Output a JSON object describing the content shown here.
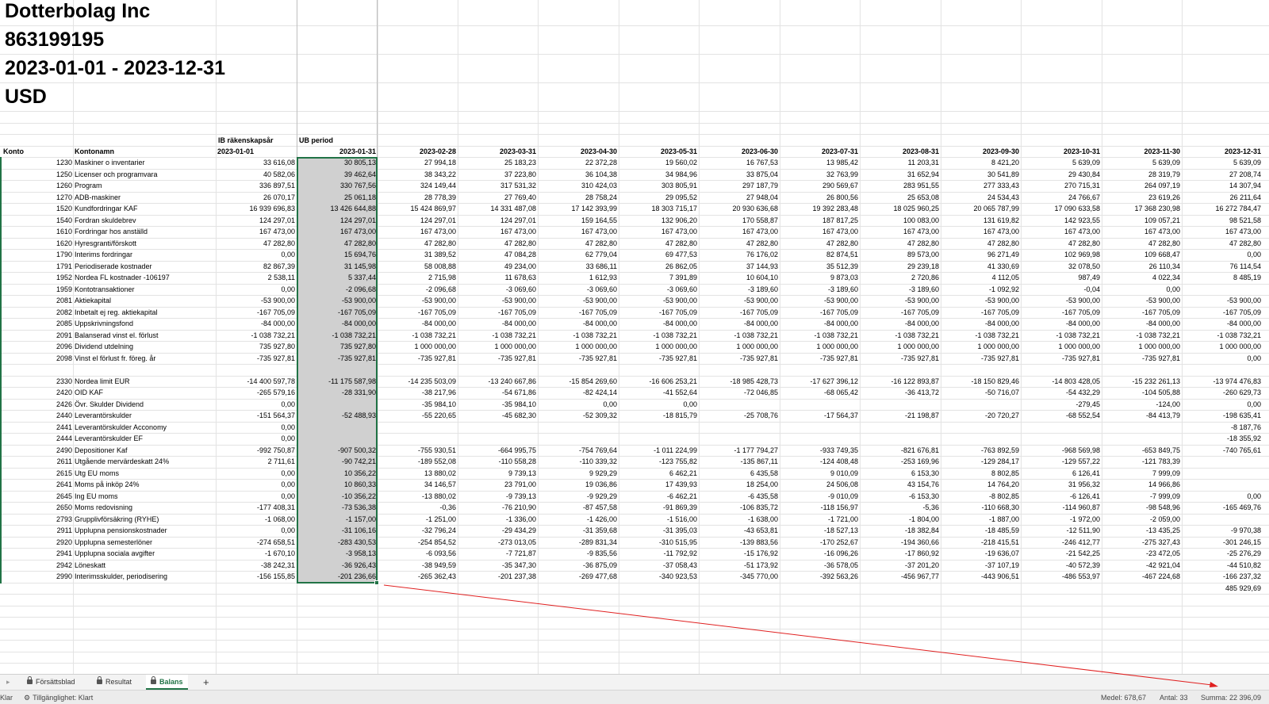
{
  "company": {
    "name": "Dotterbolag Inc",
    "org_number": "863199195",
    "period": "2023-01-01 - 2023-12-31",
    "currency": "USD"
  },
  "table": {
    "col_header_ib": "IB räkenskapsår",
    "col_header_ub": "UB period",
    "header_konto": "Konto",
    "header_kontonamn": "Kontonamn",
    "dates": [
      "2023-01-01",
      "2023-01-31",
      "2023-02-28",
      "2023-03-31",
      "2023-04-30",
      "2023-05-31",
      "2023-06-30",
      "2023-07-31",
      "2023-08-31",
      "2023-09-30",
      "2023-10-31",
      "2023-11-30",
      "2023-12-31"
    ],
    "rows": [
      {
        "konto": "1230",
        "name": "Maskiner o inventarier",
        "v": [
          "33 616,08",
          "30 805,13",
          "27 994,18",
          "25 183,23",
          "22 372,28",
          "19 560,02",
          "16 767,53",
          "13 985,42",
          "11 203,31",
          "8 421,20",
          "5 639,09",
          "5 639,09",
          "5 639,09"
        ]
      },
      {
        "konto": "1250",
        "name": "Licenser och programvara",
        "v": [
          "40 582,06",
          "39 462,64",
          "38 343,22",
          "37 223,80",
          "36 104,38",
          "34 984,96",
          "33 875,04",
          "32 763,99",
          "31 652,94",
          "30 541,89",
          "29 430,84",
          "28 319,79",
          "27 208,74"
        ]
      },
      {
        "konto": "1260",
        "name": "Program",
        "v": [
          "336 897,51",
          "330 767,56",
          "324 149,44",
          "317 531,32",
          "310 424,03",
          "303 805,91",
          "297 187,79",
          "290 569,67",
          "283 951,55",
          "277 333,43",
          "270 715,31",
          "264 097,19",
          "14 307,94"
        ]
      },
      {
        "konto": "1270",
        "name": "ADB-maskiner",
        "v": [
          "26 070,17",
          "25 061,18",
          "28 778,39",
          "27 769,40",
          "28 758,24",
          "29 095,52",
          "27 948,04",
          "26 800,56",
          "25 653,08",
          "24 534,43",
          "24 766,67",
          "23 619,26",
          "26 211,64"
        ]
      },
      {
        "konto": "1520",
        "name": "Kundfordringar KAF",
        "v": [
          "16 939 696,83",
          "13 426 644,88",
          "15 424 869,97",
          "14 331 487,08",
          "17 142 393,99",
          "18 303 715,17",
          "20 930 636,68",
          "19 392 283,48",
          "18 025 960,25",
          "20 065 787,99",
          "17 090 633,58",
          "17 368 230,98",
          "16 272 784,47"
        ]
      },
      {
        "konto": "1540",
        "name": "Fordran skuldebrev",
        "v": [
          "124 297,01",
          "124 297,01",
          "124 297,01",
          "124 297,01",
          "159 164,55",
          "132 906,20",
          "170 558,87",
          "187 817,25",
          "100 083,00",
          "131 619,82",
          "142 923,55",
          "109 057,21",
          "98 521,58"
        ]
      },
      {
        "konto": "1610",
        "name": "Fordringar hos anställd",
        "v": [
          "167 473,00",
          "167 473,00",
          "167 473,00",
          "167 473,00",
          "167 473,00",
          "167 473,00",
          "167 473,00",
          "167 473,00",
          "167 473,00",
          "167 473,00",
          "167 473,00",
          "167 473,00",
          "167 473,00"
        ]
      },
      {
        "konto": "1620",
        "name": "Hyresgranti/förskott",
        "v": [
          "47 282,80",
          "47 282,80",
          "47 282,80",
          "47 282,80",
          "47 282,80",
          "47 282,80",
          "47 282,80",
          "47 282,80",
          "47 282,80",
          "47 282,80",
          "47 282,80",
          "47 282,80",
          "47 282,80"
        ]
      },
      {
        "konto": "1790",
        "name": "Interims fordringar",
        "v": [
          "0,00",
          "15 694,76",
          "31 389,52",
          "47 084,28",
          "62 779,04",
          "69 477,53",
          "76 176,02",
          "82 874,51",
          "89 573,00",
          "96 271,49",
          "102 969,98",
          "109 668,47",
          "0,00"
        ]
      },
      {
        "konto": "1791",
        "name": "Periodiserade kostnader",
        "v": [
          "82 867,39",
          "31 145,98",
          "58 008,88",
          "49 234,00",
          "33 686,11",
          "26 862,05",
          "37 144,93",
          "35 512,39",
          "29 239,18",
          "41 330,69",
          "32 078,50",
          "26 110,34",
          "76 114,54"
        ]
      },
      {
        "konto": "1952",
        "name": "Nordea FL kostnader -106197",
        "v": [
          "2 538,11",
          "5 337,44",
          "2 715,98",
          "11 678,63",
          "1 612,93",
          "7 391,89",
          "10 604,10",
          "9 873,03",
          "2 720,86",
          "4 112,05",
          "987,49",
          "4 022,34",
          "8 485,19"
        ]
      },
      {
        "konto": "1959",
        "name": "Kontotransaktioner",
        "v": [
          "0,00",
          "-2 096,68",
          "-2 096,68",
          "-3 069,60",
          "-3 069,60",
          "-3 069,60",
          "-3 189,60",
          "-3 189,60",
          "-3 189,60",
          "-1 092,92",
          "-0,04",
          "0,00",
          ""
        ]
      },
      {
        "konto": "2081",
        "name": "Aktiekapital",
        "v": [
          "-53 900,00",
          "-53 900,00",
          "-53 900,00",
          "-53 900,00",
          "-53 900,00",
          "-53 900,00",
          "-53 900,00",
          "-53 900,00",
          "-53 900,00",
          "-53 900,00",
          "-53 900,00",
          "-53 900,00",
          "-53 900,00"
        ]
      },
      {
        "konto": "2082",
        "name": "Inbetalt ej reg. aktiekapital",
        "v": [
          "-167 705,09",
          "-167 705,09",
          "-167 705,09",
          "-167 705,09",
          "-167 705,09",
          "-167 705,09",
          "-167 705,09",
          "-167 705,09",
          "-167 705,09",
          "-167 705,09",
          "-167 705,09",
          "-167 705,09",
          "-167 705,09"
        ]
      },
      {
        "konto": "2085",
        "name": "Uppskrivningsfond",
        "v": [
          "-84 000,00",
          "-84 000,00",
          "-84 000,00",
          "-84 000,00",
          "-84 000,00",
          "-84 000,00",
          "-84 000,00",
          "-84 000,00",
          "-84 000,00",
          "-84 000,00",
          "-84 000,00",
          "-84 000,00",
          "-84 000,00"
        ]
      },
      {
        "konto": "2091",
        "name": "Balanserad vinst el. förlust",
        "v": [
          "-1 038 732,21",
          "-1 038 732,21",
          "-1 038 732,21",
          "-1 038 732,21",
          "-1 038 732,21",
          "-1 038 732,21",
          "-1 038 732,21",
          "-1 038 732,21",
          "-1 038 732,21",
          "-1 038 732,21",
          "-1 038 732,21",
          "-1 038 732,21",
          "-1 038 732,21"
        ]
      },
      {
        "konto": "2096",
        "name": "Dividend utdelning",
        "v": [
          "735 927,80",
          "735 927,80",
          "1 000 000,00",
          "1 000 000,00",
          "1 000 000,00",
          "1 000 000,00",
          "1 000 000,00",
          "1 000 000,00",
          "1 000 000,00",
          "1 000 000,00",
          "1 000 000,00",
          "1 000 000,00",
          "1 000 000,00"
        ]
      },
      {
        "konto": "2098",
        "name": "Vinst el förlust fr. föreg. år",
        "v": [
          "-735 927,81",
          "-735 927,81",
          "-735 927,81",
          "-735 927,81",
          "-735 927,81",
          "-735 927,81",
          "-735 927,81",
          "-735 927,81",
          "-735 927,81",
          "-735 927,81",
          "-735 927,81",
          "-735 927,81",
          "0,00"
        ]
      },
      {
        "konto": "",
        "name": "",
        "v": [
          "",
          "",
          "",
          "",
          "",
          "",
          "",
          "",
          "",
          "",
          "",
          "",
          ""
        ]
      },
      {
        "konto": "2330",
        "name": "Nordea limit EUR",
        "v": [
          "-14 400 597,78",
          "-11 175 587,98",
          "-14 235 503,09",
          "-13 240 667,86",
          "-15 854 269,60",
          "-16 606 253,21",
          "-18 985 428,73",
          "-17 627 396,12",
          "-16 122 893,87",
          "-18 150 829,46",
          "-14 803 428,05",
          "-15 232 261,13",
          "-13 974 476,83"
        ]
      },
      {
        "konto": "2420",
        "name": "OID KAF",
        "v": [
          "-265 579,16",
          "-28 331,90",
          "-38 217,96",
          "-54 671,86",
          "-82 424,14",
          "-41 552,64",
          "-72 046,85",
          "-68 065,42",
          "-36 413,72",
          "-50 716,07",
          "-54 432,29",
          "-104 505,88",
          "-260 629,73"
        ]
      },
      {
        "konto": "2426",
        "name": "Övr. Skulder Dividend",
        "v": [
          "0,00",
          "",
          "-35 984,10",
          "-35 984,10",
          "0,00",
          "0,00",
          "",
          "",
          "",
          "",
          "-279,45",
          "-124,00",
          "0,00"
        ]
      },
      {
        "konto": "2440",
        "name": "Leverantörskulder",
        "v": [
          "-151 564,37",
          "-52 488,93",
          "-55 220,65",
          "-45 682,30",
          "-52 309,32",
          "-18 815,79",
          "-25 708,76",
          "-17 564,37",
          "-21 198,87",
          "-20 720,27",
          "-68 552,54",
          "-84 413,79",
          "-198 635,41"
        ]
      },
      {
        "konto": "2441",
        "name": "Leverantörskulder Acconomy",
        "v": [
          "0,00",
          "",
          "",
          "",
          "",
          "",
          "",
          "",
          "",
          "",
          "",
          "",
          "-8 187,76"
        ]
      },
      {
        "konto": "2444",
        "name": "Leverantörskulder EF",
        "v": [
          "0,00",
          "",
          "",
          "",
          "",
          "",
          "",
          "",
          "",
          "",
          "",
          "",
          "-18 355,92"
        ]
      },
      {
        "konto": "2490",
        "name": "Depositioner Kaf",
        "v": [
          "-992 750,87",
          "-907 500,32",
          "-755 930,51",
          "-664 995,75",
          "-754 769,64",
          "-1 011 224,99",
          "-1 177 794,27",
          "-933 749,35",
          "-821 676,81",
          "-763 892,59",
          "-968 569,98",
          "-653 849,75",
          "-740 765,61"
        ]
      },
      {
        "konto": "2611",
        "name": "Utgående mervärdeskatt 24%",
        "v": [
          "2 711,61",
          "-90 742,21",
          "-189 552,08",
          "-110 558,28",
          "-110 339,32",
          "-123 755,82",
          "-135 867,11",
          "-124 408,48",
          "-253 169,96",
          "-129 284,17",
          "-129 557,22",
          "-121 783,39",
          ""
        ]
      },
      {
        "konto": "2615",
        "name": "Utg EU moms",
        "v": [
          "0,00",
          "10 356,22",
          "13 880,02",
          "9 739,13",
          "9 929,29",
          "6 462,21",
          "6 435,58",
          "9 010,09",
          "6 153,30",
          "8 802,85",
          "6 126,41",
          "7 999,09",
          ""
        ]
      },
      {
        "konto": "2641",
        "name": "Moms på inköp 24%",
        "v": [
          "0,00",
          "10 860,33",
          "34 146,57",
          "23 791,00",
          "19 036,86",
          "17 439,93",
          "18 254,00",
          "24 506,08",
          "43 154,76",
          "14 764,20",
          "31 956,32",
          "14 966,86",
          ""
        ]
      },
      {
        "konto": "2645",
        "name": "Ing EU moms",
        "v": [
          "0,00",
          "-10 356,22",
          "-13 880,02",
          "-9 739,13",
          "-9 929,29",
          "-6 462,21",
          "-6 435,58",
          "-9 010,09",
          "-6 153,30",
          "-8 802,85",
          "-6 126,41",
          "-7 999,09",
          "0,00"
        ]
      },
      {
        "konto": "2650",
        "name": "Moms redovisning",
        "v": [
          "-177 408,31",
          "-73 536,38",
          "-0,36",
          "-76 210,90",
          "-87 457,58",
          "-91 869,39",
          "-106 835,72",
          "-118 156,97",
          "-5,36",
          "-110 668,30",
          "-114 960,87",
          "-98 548,96",
          "-165 469,76"
        ]
      },
      {
        "konto": "2793",
        "name": "Grupplivförsäkring (RYHE)",
        "v": [
          "-1 068,00",
          "-1 157,00",
          "-1 251,00",
          "-1 336,00",
          "-1 426,00",
          "-1 516,00",
          "-1 638,00",
          "-1 721,00",
          "-1 804,00",
          "-1 887,00",
          "-1 972,00",
          "-2 059,00",
          ""
        ]
      },
      {
        "konto": "2911",
        "name": "Upplupna pensionskostnader",
        "v": [
          "0,00",
          "-31 106,16",
          "-32 796,24",
          "-29 434,29",
          "-31 359,68",
          "-31 395,03",
          "-43 653,81",
          "-18 527,13",
          "-18 382,84",
          "-18 485,59",
          "-12 511,90",
          "-13 435,25",
          "-9 970,38"
        ]
      },
      {
        "konto": "2920",
        "name": "Upplupna semesterlöner",
        "v": [
          "-274 658,51",
          "-283 430,53",
          "-254 854,52",
          "-273 013,05",
          "-289 831,34",
          "-310 515,95",
          "-139 883,56",
          "-170 252,67",
          "-194 360,66",
          "-218 415,51",
          "-246 412,77",
          "-275 327,43",
          "-301 246,15"
        ]
      },
      {
        "konto": "2941",
        "name": "Upplupna sociala avgifter",
        "v": [
          "-1 670,10",
          "-3 958,13",
          "-6 093,56",
          "-7 721,87",
          "-9 835,56",
          "-11 792,92",
          "-15 176,92",
          "-16 096,26",
          "-17 860,92",
          "-19 636,07",
          "-21 542,25",
          "-23 472,05",
          "-25 276,29"
        ]
      },
      {
        "konto": "2942",
        "name": "Löneskatt",
        "v": [
          "-38 242,31",
          "-36 926,43",
          "-38 949,59",
          "-35 347,30",
          "-36 875,09",
          "-37 058,43",
          "-51 173,92",
          "-36 578,05",
          "-37 201,20",
          "-37 107,19",
          "-40 572,39",
          "-42 921,04",
          "-44 510,82"
        ]
      },
      {
        "konto": "2990",
        "name": "Interimsskulder, periodisering",
        "v": [
          "-156 155,85",
          "-201 236,66",
          "-265 362,43",
          "-201 237,38",
          "-269 477,68",
          "-340 923,53",
          "-345 770,00",
          "-392 563,26",
          "-456 967,77",
          "-443 906,51",
          "-486 553,97",
          "-467 224,68",
          "-166 237,32"
        ]
      }
    ],
    "total_last": "485 929,69"
  },
  "sheet_tabs": [
    {
      "label": "Försättsblad",
      "locked": true
    },
    {
      "label": "Resultat",
      "locked": true
    },
    {
      "label": "Balans",
      "locked": true,
      "active": true
    }
  ],
  "status": {
    "ready": "Klar",
    "accessibility": "Tillgänglighet: Klart",
    "average": "Medel: 678,67",
    "count": "Antal: 33",
    "sum": "Summa: 22 396,09"
  },
  "colors": {
    "accent": "#217346",
    "arrow": "#e02020",
    "selection": "#d0d0d0"
  }
}
